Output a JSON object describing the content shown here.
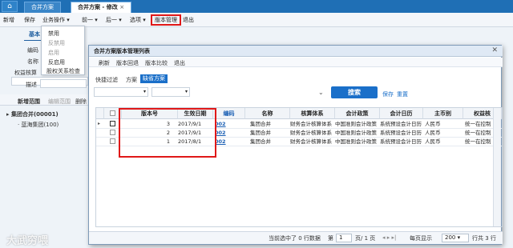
{
  "top": {
    "tabs": [
      "合并方案",
      "合并方案 - 修改"
    ],
    "home_icon": "home-icon",
    "close_glyph": "×"
  },
  "toolbar": {
    "new_label": "新增",
    "save_label": "保存",
    "biz_label": "业务操作",
    "prev_label": "前一",
    "next_label": "后一",
    "options_label": "选项",
    "version_label": "版本管理",
    "exit_label": "退出"
  },
  "dropdown": {
    "items": [
      "禁用",
      "反禁用",
      "启用",
      "反启用",
      "股权关系检查"
    ],
    "disabled": [
      false,
      true,
      true,
      false,
      false
    ]
  },
  "form": {
    "basic_tab": "基本",
    "code_label": "编码",
    "name_label": "名称",
    "equity_label": "权益核算",
    "desc_label": "描述"
  },
  "tree": {
    "tabs": [
      "新增范围",
      "编辑范围",
      "删除"
    ],
    "root": "集团合并(00001)",
    "child": "蓝海集团(100)"
  },
  "modal": {
    "title": "合并方案版本管理列表",
    "actions": [
      "刷新",
      "版本回退",
      "版本比较",
      "退出"
    ],
    "filter_label": "快捷过滤",
    "scheme_label": "方案",
    "default_scheme": "缺省方案",
    "search_label": "搜索",
    "save_label": "保存",
    "reset_label": "重置",
    "columns": [
      "版本号",
      "生效日期",
      "编码",
      "名称",
      "核算体系",
      "会计政策",
      "会计日历",
      "主币别",
      "权益核"
    ],
    "rows": [
      {
        "ver": "3",
        "date": "2017/9/1",
        "code": "002",
        "name": "集团合并",
        "sys": "财务会计核算体系",
        "policy": "中国准则会计政策",
        "cal": "系统预设会计日历",
        "cur": "人民币",
        "eq": "统一在控制"
      },
      {
        "ver": "2",
        "date": "2017/9/1",
        "code": "002",
        "name": "集团合并",
        "sys": "财务会计核算体系",
        "policy": "中国准则会计政策",
        "cal": "系统预设会计日历",
        "cur": "人民币",
        "eq": "统一在控制"
      },
      {
        "ver": "1",
        "date": "2017/8/1",
        "code": "002",
        "name": "集团合并",
        "sys": "财务会计核算体系",
        "policy": "中国准则会计政策",
        "cal": "系统预设会计日历",
        "cur": "人民币",
        "eq": "统一在控制"
      }
    ],
    "status": {
      "selected": "当前选中了 0 行数据",
      "page_prefix": "第",
      "page_value": "1",
      "page_suffix": "页/ 1 页",
      "per_page_label": "每页显示",
      "per_page_value": "200",
      "total": "行共 3 行"
    }
  },
  "watermark": "大武穷喂"
}
